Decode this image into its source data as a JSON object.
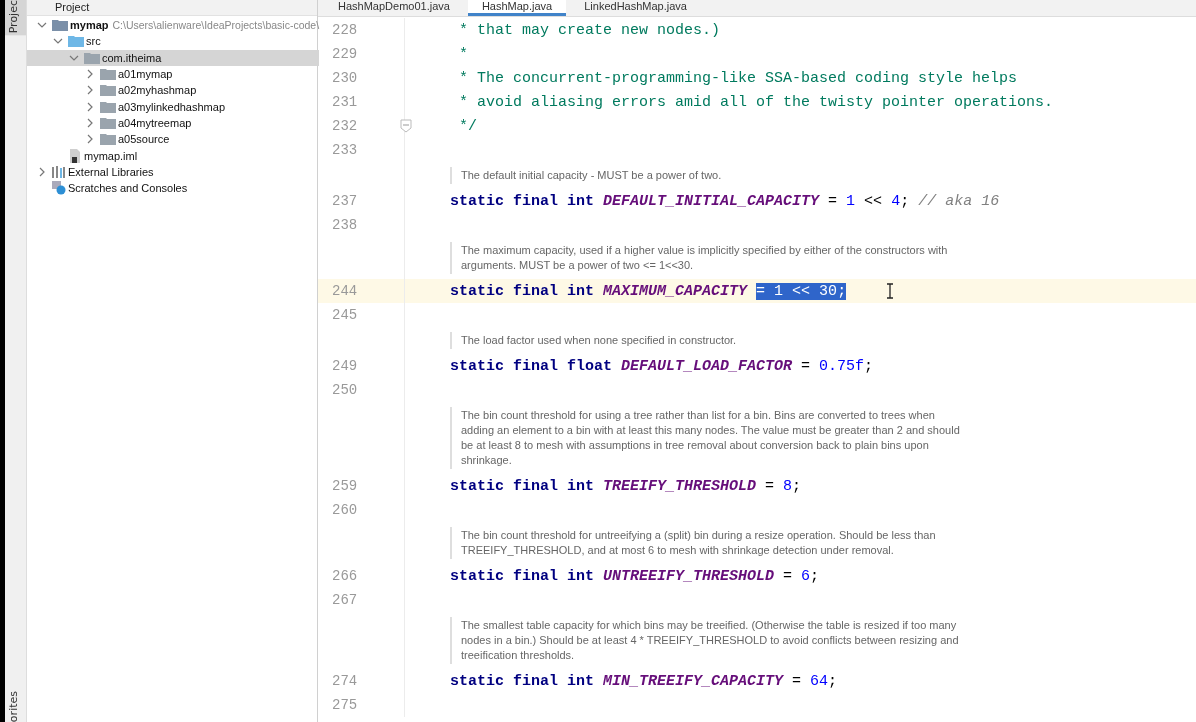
{
  "side_stripe": {
    "top_label": "Projec",
    "bottom_label": "orites"
  },
  "project_panel": {
    "title": "Project",
    "tree": [
      {
        "label": "mymap",
        "kind": "module",
        "path": "C:\\Users\\alienware\\IdeaProjects\\basic-code\\",
        "expanded": true,
        "selected": false,
        "children": [
          {
            "label": "src",
            "kind": "source",
            "expanded": true,
            "selected": false,
            "children": [
              {
                "label": "com.itheima",
                "kind": "package",
                "expanded": true,
                "selected": true,
                "children": [
                  {
                    "label": "a01mymap",
                    "kind": "package",
                    "expanded": false,
                    "selected": false
                  },
                  {
                    "label": "a02myhashmap",
                    "kind": "package",
                    "expanded": false,
                    "selected": false
                  },
                  {
                    "label": "a03mylinkedhashmap",
                    "kind": "package",
                    "expanded": false,
                    "selected": false
                  },
                  {
                    "label": "a04mytreemap",
                    "kind": "package",
                    "expanded": false,
                    "selected": false
                  },
                  {
                    "label": "a05source",
                    "kind": "package",
                    "expanded": false,
                    "selected": false
                  }
                ]
              }
            ]
          },
          {
            "label": "mymap.iml",
            "kind": "file",
            "selected": false
          }
        ]
      },
      {
        "label": "External Libraries",
        "kind": "libraries",
        "expanded": false,
        "selected": false
      },
      {
        "label": "Scratches and Consoles",
        "kind": "scratches",
        "selected": false
      }
    ]
  },
  "tabs": [
    {
      "label": "HashMapDemo01.java",
      "selected": false
    },
    {
      "label": "HashMap.java",
      "selected": true
    },
    {
      "label": "LinkedHashMap.java",
      "selected": false
    }
  ],
  "editor": {
    "rows": [
      {
        "kind": "code",
        "line": "228",
        "current": false,
        "tokens": [
          {
            "text": " * that may create new nodes.)",
            "kind": "doc",
            "selected": false
          }
        ]
      },
      {
        "kind": "code",
        "line": "229",
        "current": false,
        "tokens": [
          {
            "text": " *",
            "kind": "doc",
            "selected": false
          }
        ]
      },
      {
        "kind": "code",
        "line": "230",
        "current": false,
        "tokens": [
          {
            "text": " * The concurrent-programming-like SSA-based coding style helps",
            "kind": "doc",
            "selected": false
          }
        ]
      },
      {
        "kind": "code",
        "line": "231",
        "current": false,
        "tokens": [
          {
            "text": " * avoid aliasing errors amid all of the twisty pointer operations.",
            "kind": "doc",
            "selected": false
          }
        ]
      },
      {
        "kind": "code",
        "line": "232",
        "current": false,
        "fold": true,
        "tokens": [
          {
            "text": " */",
            "kind": "doc",
            "selected": false
          }
        ]
      },
      {
        "kind": "code",
        "line": "233",
        "current": false,
        "tokens": []
      },
      {
        "kind": "doc",
        "text": "The default initial capacity - MUST be a power of two."
      },
      {
        "kind": "code",
        "line": "237",
        "current": false,
        "tokens": [
          {
            "text": "static final int ",
            "kind": "kw",
            "selected": false
          },
          {
            "text": "DEFAULT_INITIAL_CAPACITY",
            "kind": "const",
            "selected": false
          },
          {
            "text": " = ",
            "kind": "op",
            "selected": false
          },
          {
            "text": "1",
            "kind": "num",
            "selected": false
          },
          {
            "text": " << ",
            "kind": "op",
            "selected": false
          },
          {
            "text": "4",
            "kind": "num",
            "selected": false
          },
          {
            "text": "; ",
            "kind": "op",
            "selected": false
          },
          {
            "text": "// aka 16",
            "kind": "comment",
            "selected": false
          }
        ]
      },
      {
        "kind": "code",
        "line": "238",
        "current": false,
        "tokens": []
      },
      {
        "kind": "doc",
        "text": "The maximum capacity, used if a higher value is implicitly specified by either of the constructors with arguments. MUST be a power of two <= 1<<30."
      },
      {
        "kind": "code",
        "line": "244",
        "current": true,
        "cursor": true,
        "tokens": [
          {
            "text": "static final int ",
            "kind": "kw",
            "selected": false
          },
          {
            "text": "MAXIMUM_CAPACITY ",
            "kind": "const",
            "selected": false
          },
          {
            "text": "= ",
            "kind": "op",
            "selected": true
          },
          {
            "text": "1",
            "kind": "num",
            "selected": true
          },
          {
            "text": " << ",
            "kind": "op",
            "selected": true
          },
          {
            "text": "30",
            "kind": "num",
            "selected": true
          },
          {
            "text": ";",
            "kind": "op",
            "selected": true
          }
        ]
      },
      {
        "kind": "code",
        "line": "245",
        "current": false,
        "tokens": []
      },
      {
        "kind": "doc",
        "text": "The load factor used when none specified in constructor."
      },
      {
        "kind": "code",
        "line": "249",
        "current": false,
        "tokens": [
          {
            "text": "static final float ",
            "kind": "kw",
            "selected": false
          },
          {
            "text": "DEFAULT_LOAD_FACTOR",
            "kind": "const",
            "selected": false
          },
          {
            "text": " = ",
            "kind": "op",
            "selected": false
          },
          {
            "text": "0.75f",
            "kind": "num",
            "selected": false
          },
          {
            "text": ";",
            "kind": "op",
            "selected": false
          }
        ]
      },
      {
        "kind": "code",
        "line": "250",
        "current": false,
        "tokens": []
      },
      {
        "kind": "doc",
        "text": "The bin count threshold for using a tree rather than list for a bin. Bins are converted to trees when adding an element to a bin with at least this many nodes. The value must be greater than 2 and should be at least 8 to mesh with assumptions in tree removal about conversion back to plain bins upon shrinkage."
      },
      {
        "kind": "code",
        "line": "259",
        "current": false,
        "tokens": [
          {
            "text": "static final int ",
            "kind": "kw",
            "selected": false
          },
          {
            "text": "TREEIFY_THRESHOLD",
            "kind": "const",
            "selected": false
          },
          {
            "text": " = ",
            "kind": "op",
            "selected": false
          },
          {
            "text": "8",
            "kind": "num",
            "selected": false
          },
          {
            "text": ";",
            "kind": "op",
            "selected": false
          }
        ]
      },
      {
        "kind": "code",
        "line": "260",
        "current": false,
        "tokens": []
      },
      {
        "kind": "doc",
        "text": "The bin count threshold for untreeifying a (split) bin during a resize operation. Should be less than TREEIFY_THRESHOLD, and at most 6 to mesh with shrinkage detection under removal."
      },
      {
        "kind": "code",
        "line": "266",
        "current": false,
        "tokens": [
          {
            "text": "static final int ",
            "kind": "kw",
            "selected": false
          },
          {
            "text": "UNTREEIFY_THRESHOLD",
            "kind": "const",
            "selected": false
          },
          {
            "text": " = ",
            "kind": "op",
            "selected": false
          },
          {
            "text": "6",
            "kind": "num",
            "selected": false
          },
          {
            "text": ";",
            "kind": "op",
            "selected": false
          }
        ]
      },
      {
        "kind": "code",
        "line": "267",
        "current": false,
        "tokens": []
      },
      {
        "kind": "doc",
        "text": "The smallest table capacity for which bins may be treeified. (Otherwise the table is resized if too many nodes in a bin.) Should be at least 4 * TREEIFY_THRESHOLD to avoid conflicts between resizing and treeification thresholds."
      },
      {
        "kind": "code",
        "line": "274",
        "current": false,
        "tokens": [
          {
            "text": "static final int ",
            "kind": "kw",
            "selected": false
          },
          {
            "text": "MIN_TREEIFY_CAPACITY",
            "kind": "const",
            "selected": false
          },
          {
            "text": " = ",
            "kind": "op",
            "selected": false
          },
          {
            "text": "64",
            "kind": "num",
            "selected": false
          },
          {
            "text": ";",
            "kind": "op",
            "selected": false
          }
        ]
      },
      {
        "kind": "code",
        "line": "275",
        "current": false,
        "tokens": []
      }
    ]
  }
}
